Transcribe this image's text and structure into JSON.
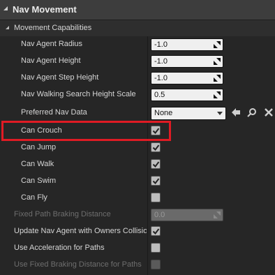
{
  "category": {
    "title": "Nav Movement"
  },
  "subcategory": {
    "title": "Movement Capabilities"
  },
  "numeric_props": [
    {
      "label": "Nav Agent Radius",
      "value": "-1.0"
    },
    {
      "label": "Nav Agent Height",
      "value": "-1.0"
    },
    {
      "label": "Nav Agent Step Height",
      "value": "-1.0"
    },
    {
      "label": "Nav Walking Search Height Scale",
      "value": "0.5"
    }
  ],
  "preferred_nav_data": {
    "label": "Preferred Nav Data",
    "value": "None"
  },
  "capabilities": [
    {
      "label": "Can Crouch",
      "checked": true
    },
    {
      "label": "Can Jump",
      "checked": true
    },
    {
      "label": "Can Walk",
      "checked": true
    },
    {
      "label": "Can Swim",
      "checked": true
    },
    {
      "label": "Can Fly",
      "checked": false
    }
  ],
  "fixed_path_braking": {
    "label": "Fixed Path Braking Distance",
    "value": "0.0"
  },
  "outer_bools": [
    {
      "label": "Update Nav Agent with Owners Collision",
      "checked": true
    },
    {
      "label": "Use Acceleration for Paths",
      "checked": false
    },
    {
      "label": "Use Fixed Braking Distance for Paths",
      "checked": false
    }
  ],
  "highlight_color": "#e01b24"
}
